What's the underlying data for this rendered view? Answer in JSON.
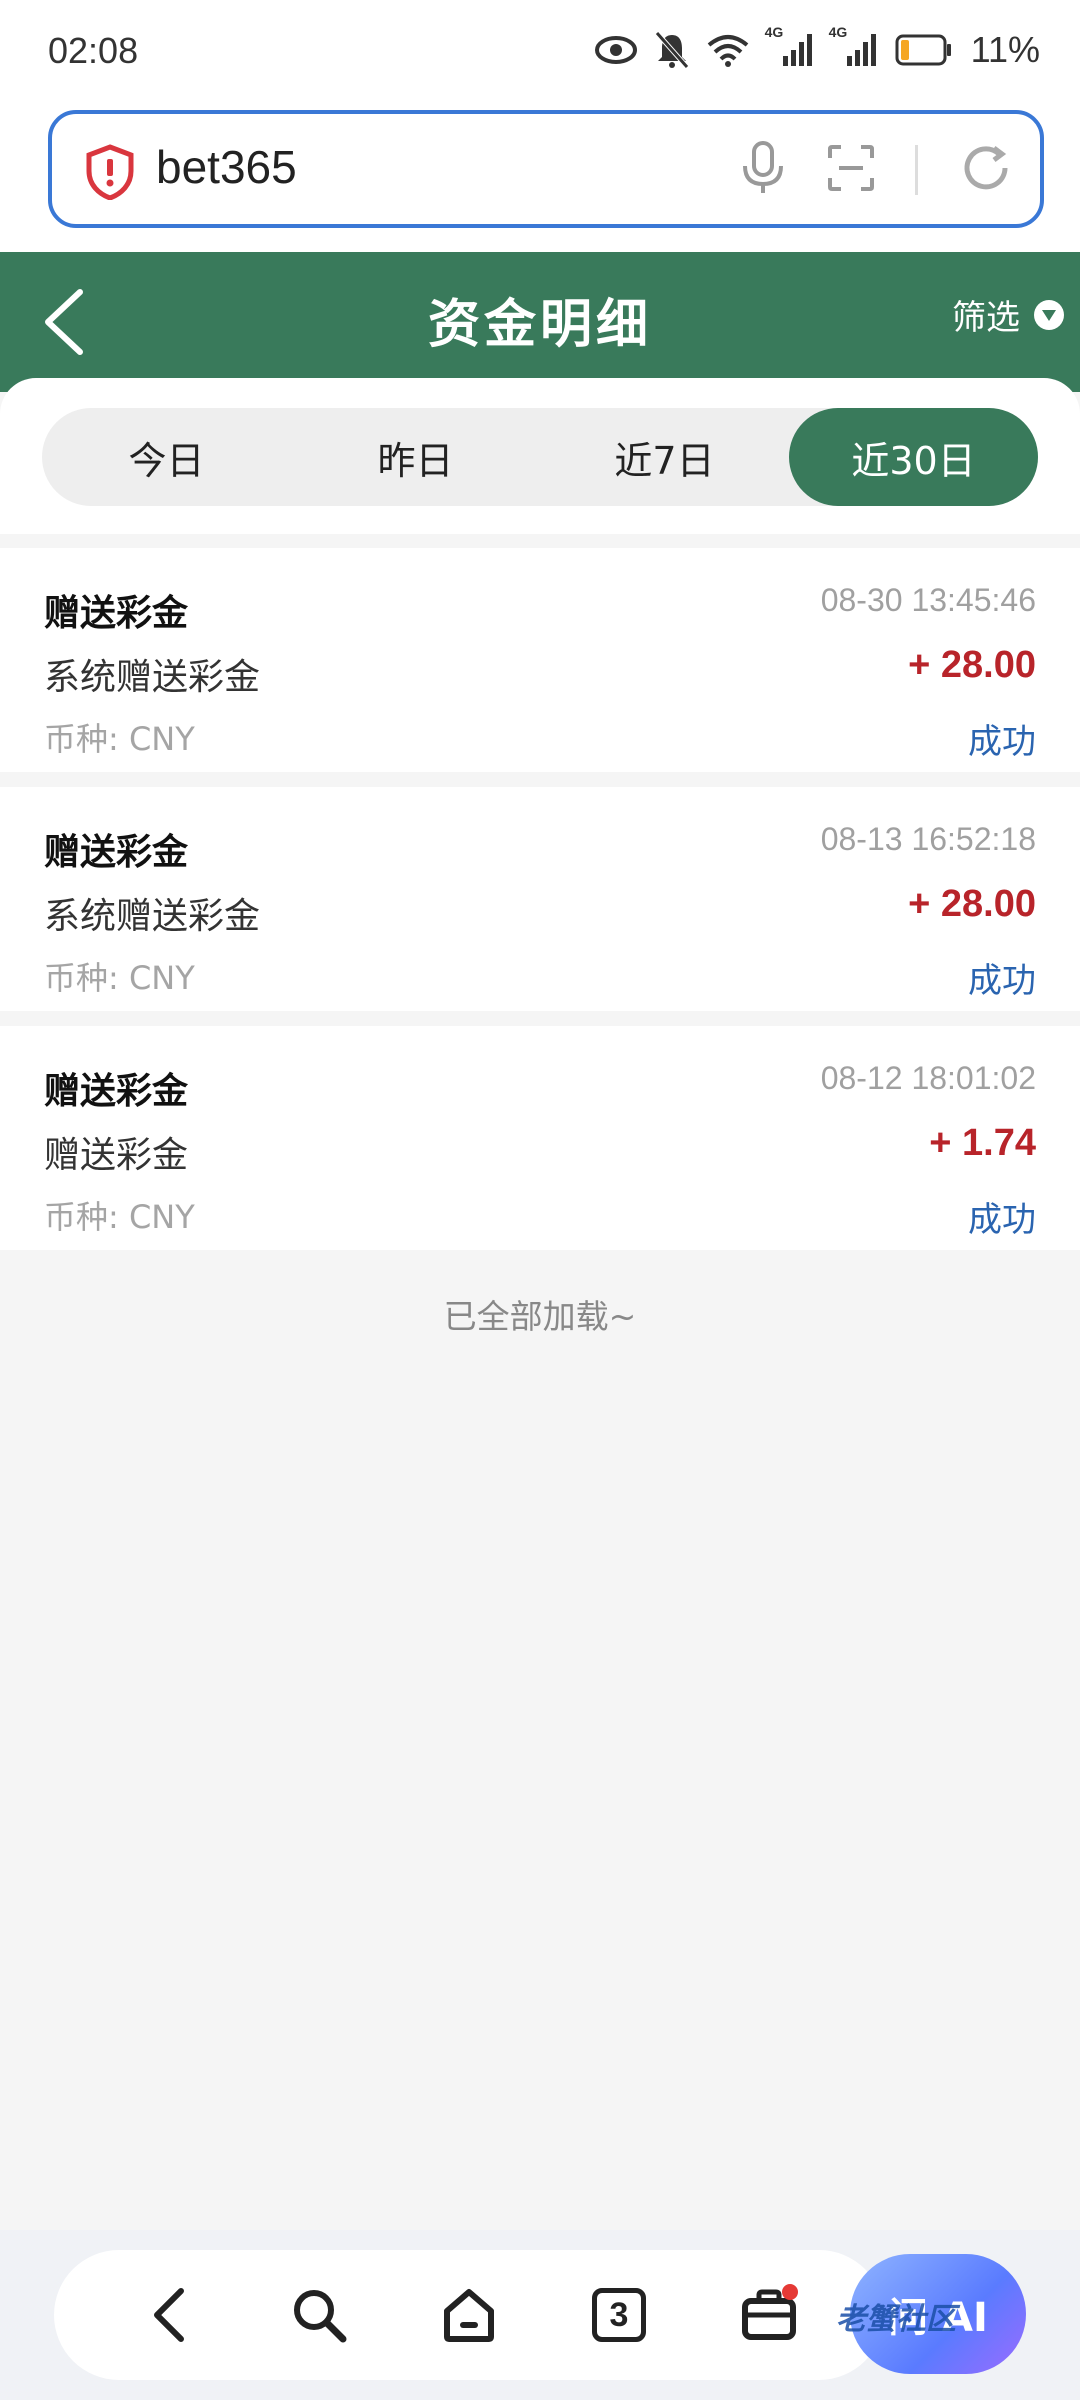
{
  "status_bar": {
    "time": "02:08",
    "net_label_1": "4G",
    "net_label_2": "4G",
    "battery": "11%"
  },
  "browser": {
    "address_text": "bet365",
    "tab_count": "3",
    "ai_label": "问 AI"
  },
  "header": {
    "title": "资金明细",
    "filter_label": "筛选"
  },
  "tabs": [
    {
      "label": "今日"
    },
    {
      "label": "昨日"
    },
    {
      "label": "近7日"
    },
    {
      "label": "近30日",
      "active": true
    }
  ],
  "records": [
    {
      "type": "赠送彩金",
      "time": "08-30 13:45:46",
      "desc": "系统赠送彩金",
      "amount": "+ 28.00",
      "currency": "币种: CNY",
      "status": "成功"
    },
    {
      "type": "赠送彩金",
      "time": "08-13 16:52:18",
      "desc": "系统赠送彩金",
      "amount": "+ 28.00",
      "currency": "币种: CNY",
      "status": "成功"
    },
    {
      "type": "赠送彩金",
      "time": "08-12 18:01:02",
      "desc": "赠送彩金",
      "amount": "+ 1.74",
      "currency": "币种: CNY",
      "status": "成功"
    }
  ],
  "footer_text": "已全部加载~",
  "watermark": "老蟹社区",
  "colors": {
    "primary_green": "#397a5b",
    "amount_red": "#b8242a",
    "status_blue": "#2a64b0",
    "address_border": "#3a78d6"
  }
}
